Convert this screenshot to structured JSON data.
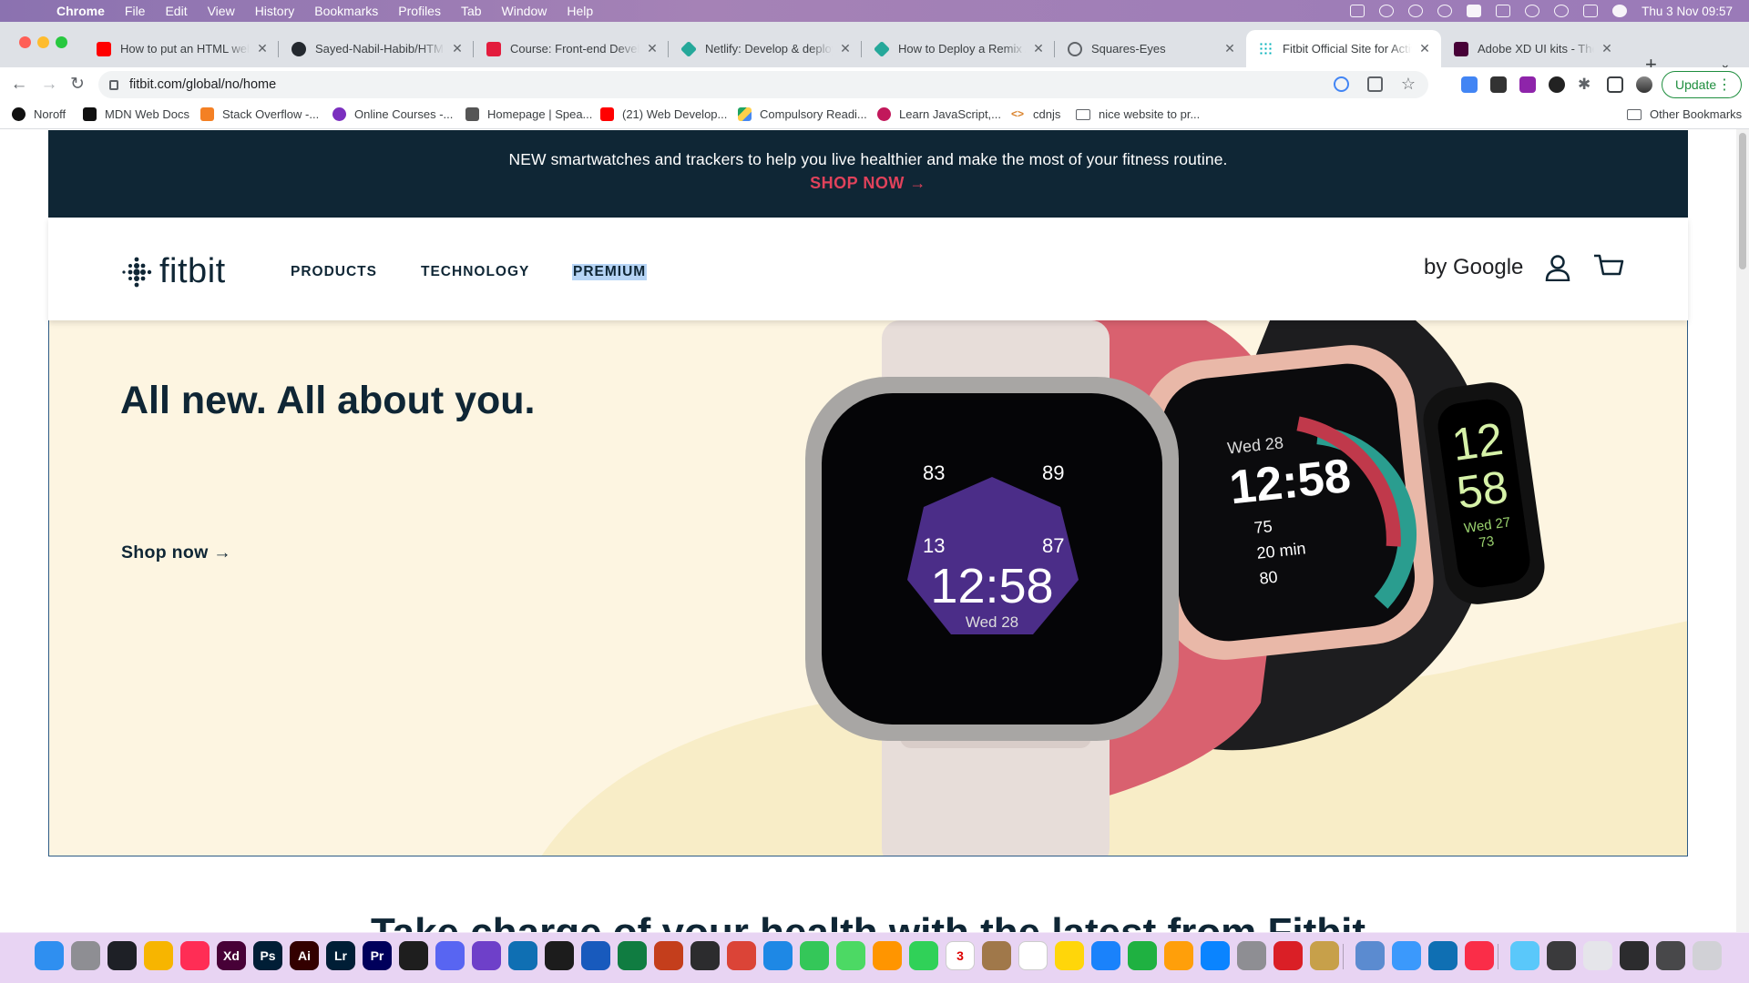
{
  "menubar": {
    "app": "Chrome",
    "items": [
      "File",
      "Edit",
      "View",
      "History",
      "Bookmarks",
      "Profiles",
      "Tab",
      "Window",
      "Help"
    ],
    "clock": "Thu 3 Nov  09:57"
  },
  "tabs": [
    {
      "title": "How to put an HTML website",
      "favicon_color": "#ff0000",
      "favicon": "youtube-icon"
    },
    {
      "title": "Sayed-Nabil-Habib/HTML-",
      "favicon_color": "#24292f",
      "favicon": "github-icon"
    },
    {
      "title": "Course: Front-end Develop",
      "favicon_color": "#e31c3d",
      "favicon": "noroff-icon"
    },
    {
      "title": "Netlify: Develop & deploy",
      "favicon_color": "#25a89a",
      "favicon": "netlify-icon"
    },
    {
      "title": "How to Deploy a Remix Ap",
      "favicon_color": "#25a89a",
      "favicon": "netlify-icon"
    },
    {
      "title": "Squares-Eyes",
      "favicon_color": "#5f6368",
      "favicon": "globe-icon"
    },
    {
      "title": "Fitbit Official Site for Activ",
      "favicon_color": "#00b0b9",
      "favicon": "fitbit-icon",
      "active": true
    },
    {
      "title": "Adobe XD UI kits - The be",
      "favicon_color": "#470137",
      "favicon": "adobe-xd-icon"
    }
  ],
  "toolbar": {
    "url": "fitbit.com/global/no/home",
    "update_label": "Update"
  },
  "bookmarks": [
    {
      "label": "Noroff",
      "color": "#111"
    },
    {
      "label": "MDN Web Docs",
      "color": "#111"
    },
    {
      "label": "Stack Overflow -...",
      "color": "#f48024"
    },
    {
      "label": "Online Courses -...",
      "color": "#7b2fbf"
    },
    {
      "label": "Homepage | Spea...",
      "color": "#555"
    },
    {
      "label": "(21) Web Develop...",
      "color": "#ff0000"
    },
    {
      "label": "Compulsory Readi...",
      "color": "#1fa463"
    },
    {
      "label": "Learn JavaScript,...",
      "color": "#c2185b"
    },
    {
      "label": "cdnjs",
      "color": "#d9822b"
    },
    {
      "label": "nice website to pr...",
      "color": "#5f6368"
    }
  ],
  "other_bookmarks": "Other Bookmarks",
  "page": {
    "promo_text": "NEW smartwatches and trackers to help you live healthier and make the most of your fitness routine.",
    "promo_cta": "SHOP NOW →",
    "logo": "fitbit",
    "nav": [
      "PRODUCTS",
      "TECHNOLOGY",
      "PREMIUM"
    ],
    "by_google": "by Google",
    "hero_title": "All new. All about you.",
    "hero_cta": "Shop now →",
    "section_heading": "Take charge of your health with the latest from Fitbit",
    "watch_sense": {
      "time": "12:58",
      "date": "Wed 28",
      "stat_tl": "83",
      "stat_tr": "89",
      "stat_bl": "13",
      "stat_br": "87"
    },
    "watch_versa": {
      "date": "Wed 28",
      "time": "12:58",
      "heart": "75",
      "active": "20 min",
      "sleep": "80"
    },
    "watch_inspire": {
      "hour": "12",
      "minute": "58",
      "date": "Wed 27",
      "heart": "73"
    },
    "colors": {
      "navy": "#0f2635",
      "accent": "#e0425b",
      "hero_bg": "#fdf5e1"
    }
  },
  "dock": [
    {
      "name": "finder",
      "color": "#2f8ff0"
    },
    {
      "name": "launchpad",
      "color": "#8e8e93"
    },
    {
      "name": "binance",
      "color": "#1e2026"
    },
    {
      "name": "sketch",
      "color": "#f7b500"
    },
    {
      "name": "app-red",
      "color": "#ff2d55"
    },
    {
      "name": "adobe-xd",
      "color": "#470137",
      "label": "Xd"
    },
    {
      "name": "photoshop",
      "color": "#001e36",
      "label": "Ps"
    },
    {
      "name": "illustrator",
      "color": "#330000",
      "label": "Ai"
    },
    {
      "name": "lightroom",
      "color": "#001e36",
      "label": "Lr"
    },
    {
      "name": "premiere",
      "color": "#00005b",
      "label": "Pr"
    },
    {
      "name": "figma",
      "color": "#1e1e1e"
    },
    {
      "name": "discord",
      "color": "#5865f2"
    },
    {
      "name": "github-desktop",
      "color": "#6e40c9"
    },
    {
      "name": "vscode",
      "color": "#0f6fb3"
    },
    {
      "name": "terminal",
      "color": "#1c1c1c"
    },
    {
      "name": "word",
      "color": "#185abd"
    },
    {
      "name": "excel",
      "color": "#107c41"
    },
    {
      "name": "powerpoint",
      "color": "#c43e1c"
    },
    {
      "name": "quicktime",
      "color": "#2c2c2e"
    },
    {
      "name": "chrome",
      "color": "#db4437"
    },
    {
      "name": "safari",
      "color": "#1e88e5"
    },
    {
      "name": "messages",
      "color": "#34c759"
    },
    {
      "name": "maps",
      "color": "#4cd964"
    },
    {
      "name": "photos",
      "color": "#ff9500"
    },
    {
      "name": "facetime",
      "color": "#30d158"
    },
    {
      "name": "calendar",
      "color": "#ffffff",
      "label": "3"
    },
    {
      "name": "contacts",
      "color": "#a0784a"
    },
    {
      "name": "reminders",
      "color": "#ffffff"
    },
    {
      "name": "notes",
      "color": "#ffd60a"
    },
    {
      "name": "keynote",
      "color": "#1a82fb"
    },
    {
      "name": "numbers",
      "color": "#1fb141"
    },
    {
      "name": "pages",
      "color": "#ff9f0a"
    },
    {
      "name": "app-store",
      "color": "#0a84ff"
    },
    {
      "name": "system-preferences",
      "color": "#8e8e93"
    },
    {
      "name": "creative-cloud",
      "color": "#da1f26"
    },
    {
      "name": "archive",
      "color": "#c7a04a"
    },
    {
      "name": "preview",
      "color": "#5b8bd0"
    },
    {
      "name": "mail",
      "color": "#3b99fc"
    },
    {
      "name": "vscode-2",
      "color": "#0f6fb3"
    },
    {
      "name": "music",
      "color": "#fa2d48"
    },
    {
      "name": "downloads",
      "color": "#5ac8fa"
    },
    {
      "name": "recent-1",
      "color": "#3a3a3c"
    },
    {
      "name": "recent-2",
      "color": "#e5e5ea"
    },
    {
      "name": "recent-3",
      "color": "#2c2c2e"
    },
    {
      "name": "recent-4",
      "color": "#48484a"
    },
    {
      "name": "trash",
      "color": "#d1d1d6"
    }
  ]
}
